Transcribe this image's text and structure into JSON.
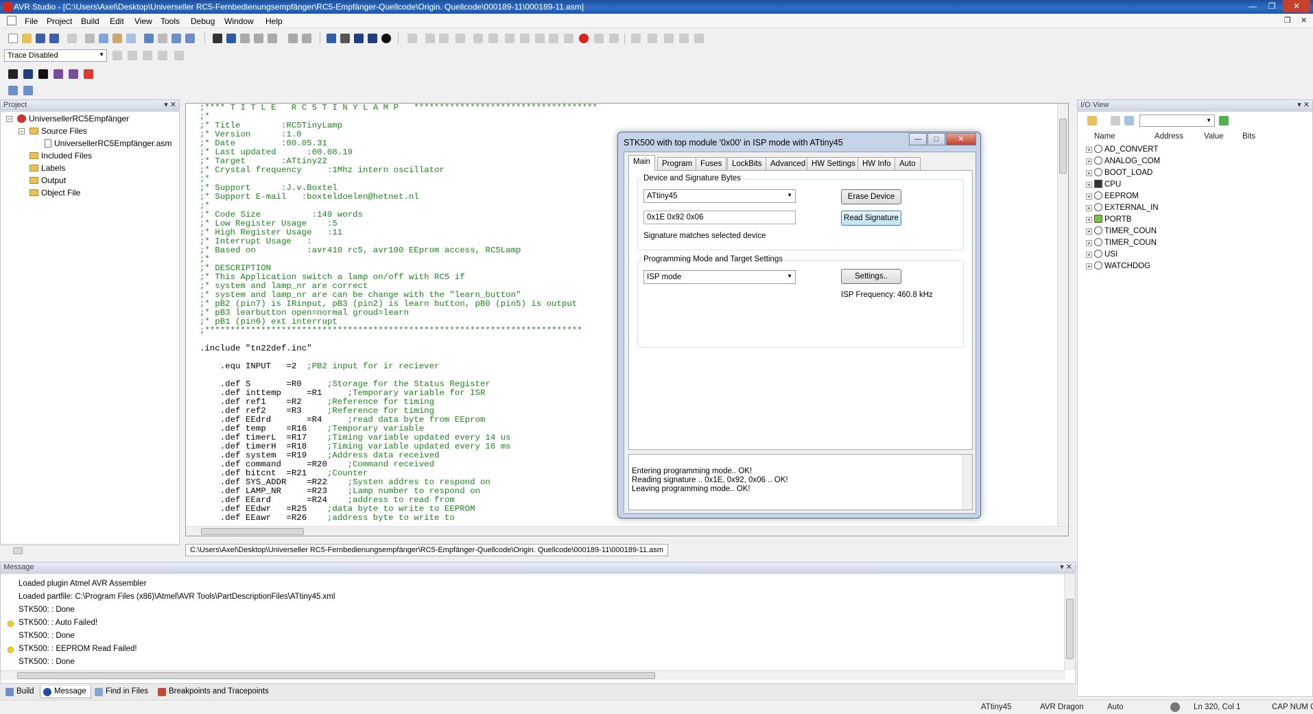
{
  "window": {
    "title": "AVR Studio - [C:\\Users\\Axel\\Desktop\\Universeller RC5-Fernbedienungsempfänger\\RC5-Empfänger-Quellcode\\Origin. Quellcode\\000189-11\\000189-11.asm]"
  },
  "menu": [
    "File",
    "Project",
    "Build",
    "Edit",
    "View",
    "Tools",
    "Debug",
    "Window",
    "Help"
  ],
  "trace": {
    "value": "Trace Disabled"
  },
  "project_pane": {
    "header": "Project",
    "items": [
      "UniversellerRC5Empfänger",
      "Source Files",
      "UniversellerRC5Empfänger.asm",
      "Included Files",
      "Labels",
      "Output",
      "Object File"
    ]
  },
  "editor": {
    "lines": [
      ";**** T I T L E   R C 5 T I N Y L A M P   ************************************",
      ";*",
      ";* Title        :RC5TinyLamp",
      ";* Version      :1.0",
      ";* Date         :00.05.31",
      ";* Last updated      :00.08.19",
      ";* Target       :ATtiny22",
      ";* Crystal frequency     :1Mhz intern oscillator",
      ";*",
      ";* Support      :J.v.Boxtel",
      ";* Support E-mail   :boxteldoelen@hetnet.nl",
      ";*",
      ";* Code Size          :149 words",
      ";* Low Register Usage    :5",
      ";* High Register Usage   :11",
      ";* Interrupt Usage   :",
      ";* Based on          :avr410 rc5, avr100 EEprom access, RC5Lamp",
      ";*",
      ";* DESCRIPTION",
      ";* This Application switch a lamp on/off with RC5 if",
      ";* system and lamp_nr are correct",
      ";* system and lamp_nr are can be change with the \"learn_button\"",
      ";* pB2 (pin7) is IRinput, pB3 (pin2) is learn button, pB0 (pin5) is output",
      ";* pB3 learbutton open=normal groud=learn",
      ";* pB1 (pin6) ext interrupt",
      ";**************************************************************************",
      "",
      ".include \"tn22def.inc\"",
      "",
      "    .equ INPUT   =2  ;PB2 input for ir reciever",
      "",
      "    .def S       =R0     ;Storage for the Status Register",
      "    .def inttemp     =R1     ;Temporary variable for ISR",
      "    .def ref1    =R2     ;Reference for timing",
      "    .def ref2    =R3     ;Reference for timing",
      "    .def EEdrd       =R4     ;read data byte from EEprom",
      "    .def temp    =R16    ;Temporary variable",
      "    .def timerL  =R17    ;Timing variable updated every 14 us",
      "    .def timerH  =R18    ;Timing variable updated every 16 ms",
      "    .def system  =R19    ;Address data received",
      "    .def command     =R20    ;Command received",
      "    .def bitcnt  =R21    ;Counter",
      "    .def SYS_ADDR    =R22    ;Systen addres to respond on",
      "    .def LAMP_NR     =R23    ;Lamp number to respond on",
      "    .def EEard       =R24    ;address to read from",
      "    .def EEdwr   =R25    ;data byte to write to EEPROM",
      "    .def EEawr   =R26    ;address byte to write to"
    ]
  },
  "file_tab": {
    "path": "C:\\Users\\Axel\\Desktop\\Universeller RC5-Fernbedienungsempfänger\\RC5-Empfänger-Quellcode\\Origin. Quellcode\\000189-11\\000189-11.asm"
  },
  "message_pane": {
    "header": "Message",
    "lines": [
      {
        "text": "Loaded plugin Atmel AVR Assembler",
        "warn": false
      },
      {
        "text": "Loaded partfile: C:\\Program Files (x86)\\Atmel\\AVR Tools\\PartDescriptionFiles\\ATtiny45.xml",
        "warn": false
      },
      {
        "text": "STK500: : Done",
        "warn": false
      },
      {
        "text": "STK500: : Auto Failed!",
        "warn": true
      },
      {
        "text": "STK500: : Done",
        "warn": false
      },
      {
        "text": "STK500: : EEPROM Read Failed!",
        "warn": true
      },
      {
        "text": "STK500: : Done",
        "warn": false
      }
    ]
  },
  "bottom_tabs": [
    "Build",
    "Message",
    "Find in Files",
    "Breakpoints and Tracepoints"
  ],
  "io_view": {
    "header": "I/O View",
    "columns": [
      "Name",
      "Address",
      "Value",
      "Bits"
    ],
    "items": [
      "AD_CONVERT",
      "ANALOG_COM",
      "BOOT_LOAD",
      "CPU",
      "EEPROM",
      "EXTERNAL_IN",
      "PORTB",
      "TIMER_COUN",
      "TIMER_COUN",
      "USI",
      "WATCHDOG"
    ]
  },
  "status_bar": {
    "device": "ATtiny45",
    "platform": "AVR Dragon",
    "mode": "Auto",
    "position": "Ln 320, Col 1",
    "indicators": "CAP  NUM  OVR"
  },
  "dialog": {
    "title": "STK500 with top module '0x00' in ISP mode with ATtiny45",
    "tabs": [
      "Main",
      "Program",
      "Fuses",
      "LockBits",
      "Advanced",
      "HW Settings",
      "HW Info",
      "Auto"
    ],
    "group1_title": "Device and Signature Bytes",
    "device": "ATtiny45",
    "erase_label": "Erase Device",
    "signature_value": "0x1E 0x92 0x06",
    "read_signature_label": "Read Signature",
    "signature_status": "Signature matches selected device",
    "group2_title": "Programming Mode and Target Settings",
    "mode": "ISP mode",
    "settings_label": "Settings..",
    "isp_freq_label": "ISP Frequency:",
    "isp_freq_value": "460.8 kHz",
    "log": [
      "Entering programming mode.. OK!",
      "Reading signature .. 0x1E, 0x92, 0x06 .. OK!",
      "Leaving programming mode.. OK!"
    ]
  }
}
